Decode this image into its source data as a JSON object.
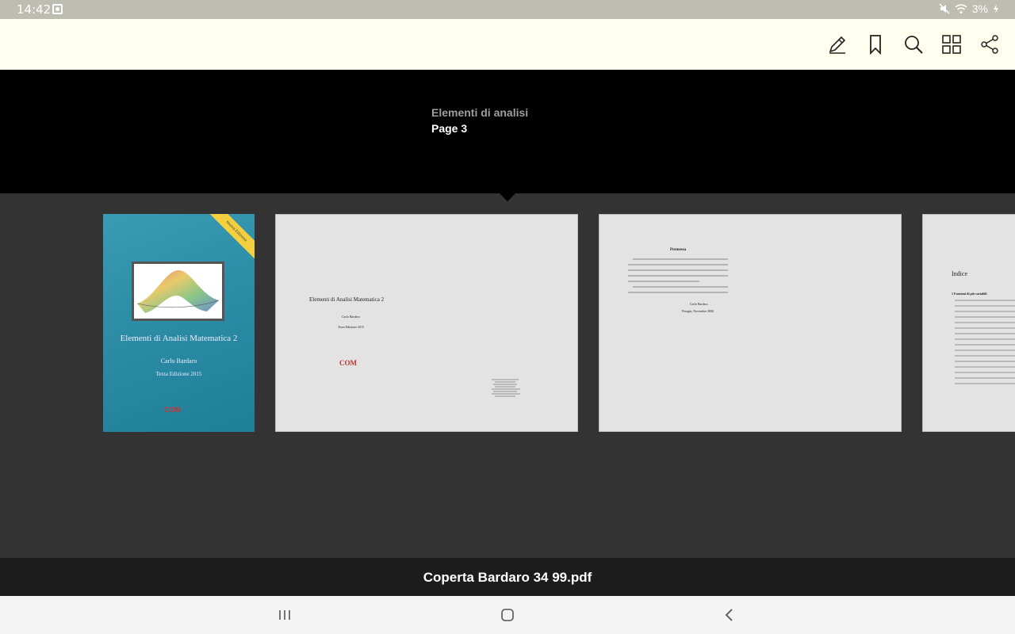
{
  "status_bar": {
    "time": "14:42",
    "battery": "3%",
    "icons": [
      "notification-icon",
      "mute-icon",
      "wifi-icon",
      "battery-charging-icon"
    ]
  },
  "toolbar": {
    "buttons": [
      "edit-icon",
      "bookmark-icon",
      "search-icon",
      "grid-view-icon",
      "share-icon"
    ],
    "background": "#fffff0"
  },
  "info_panel": {
    "doc_title": "Elementi di analisi",
    "page_label": "Page 3"
  },
  "thumbnails": {
    "cover": {
      "title": "Elementi di Analisi Matematica 2",
      "author": "Carlo Bardaro",
      "edition": "Terza Edizione 2015",
      "ribbon": "Nuova Edizione",
      "logo": "COM"
    },
    "page2": {
      "title": "Elementi di Analisi Matematica 2",
      "author": "Carlo Bardaro",
      "edition": "Terza Edizione 2015",
      "logo": "COM"
    },
    "page3": {
      "heading": "Premessa",
      "signature": "Carlo Bardaro",
      "place_date": "Perugia, Novembre 2006"
    },
    "page4": {
      "heading": "Indice",
      "section": "1  Funzioni di più variabili"
    }
  },
  "footer": {
    "filename": "Coperta Bardaro 34 99.pdf"
  },
  "nav_bar": {
    "buttons": [
      "recent-apps-icon",
      "home-icon",
      "back-icon"
    ]
  },
  "colors": {
    "status_bar": "#bdbdb2",
    "info_panel": "#000000",
    "strip": "#333333",
    "footer": "#1c1c1c",
    "nav": "#f4f4f4"
  }
}
